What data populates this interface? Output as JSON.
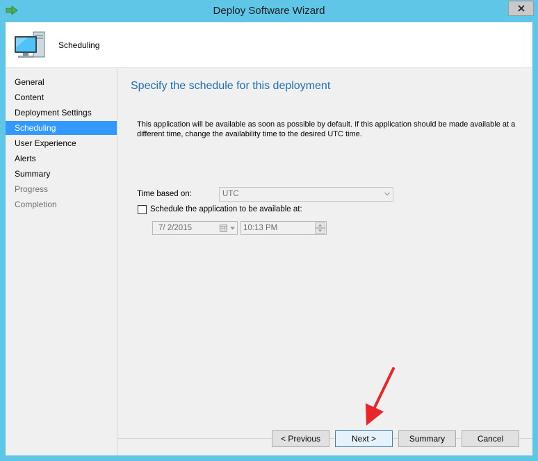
{
  "window": {
    "title": "Deploy Software Wizard",
    "close_symbol": "✕"
  },
  "header": {
    "title": "Scheduling",
    "icon": "computer-icon"
  },
  "sidebar": {
    "items": [
      {
        "label": "General",
        "state": "normal"
      },
      {
        "label": "Content",
        "state": "normal"
      },
      {
        "label": "Deployment Settings",
        "state": "normal"
      },
      {
        "label": "Scheduling",
        "state": "active"
      },
      {
        "label": "User Experience",
        "state": "normal"
      },
      {
        "label": "Alerts",
        "state": "normal"
      },
      {
        "label": "Summary",
        "state": "normal"
      },
      {
        "label": "Progress",
        "state": "disabled"
      },
      {
        "label": "Completion",
        "state": "disabled"
      }
    ]
  },
  "main": {
    "title": "Specify the schedule for this deployment",
    "description": "This application will be available as soon as possible by default. If this application should be made available at a different time, change the availability time to the desired UTC time.",
    "time_based_label": "Time based on:",
    "time_based_value": "UTC",
    "schedule_checkbox_label": "Schedule the application to be available at:",
    "schedule_checked": false,
    "date_value": "7/  2/2015",
    "time_value": "10:13 PM"
  },
  "buttons": {
    "previous": "< Previous",
    "next": "Next >",
    "summary": "Summary",
    "cancel": "Cancel"
  },
  "colors": {
    "titlebar": "#60c6e8",
    "active_nav": "#3399ff",
    "heading": "#1f6fb4",
    "annotation_arrow": "#e8262a"
  }
}
